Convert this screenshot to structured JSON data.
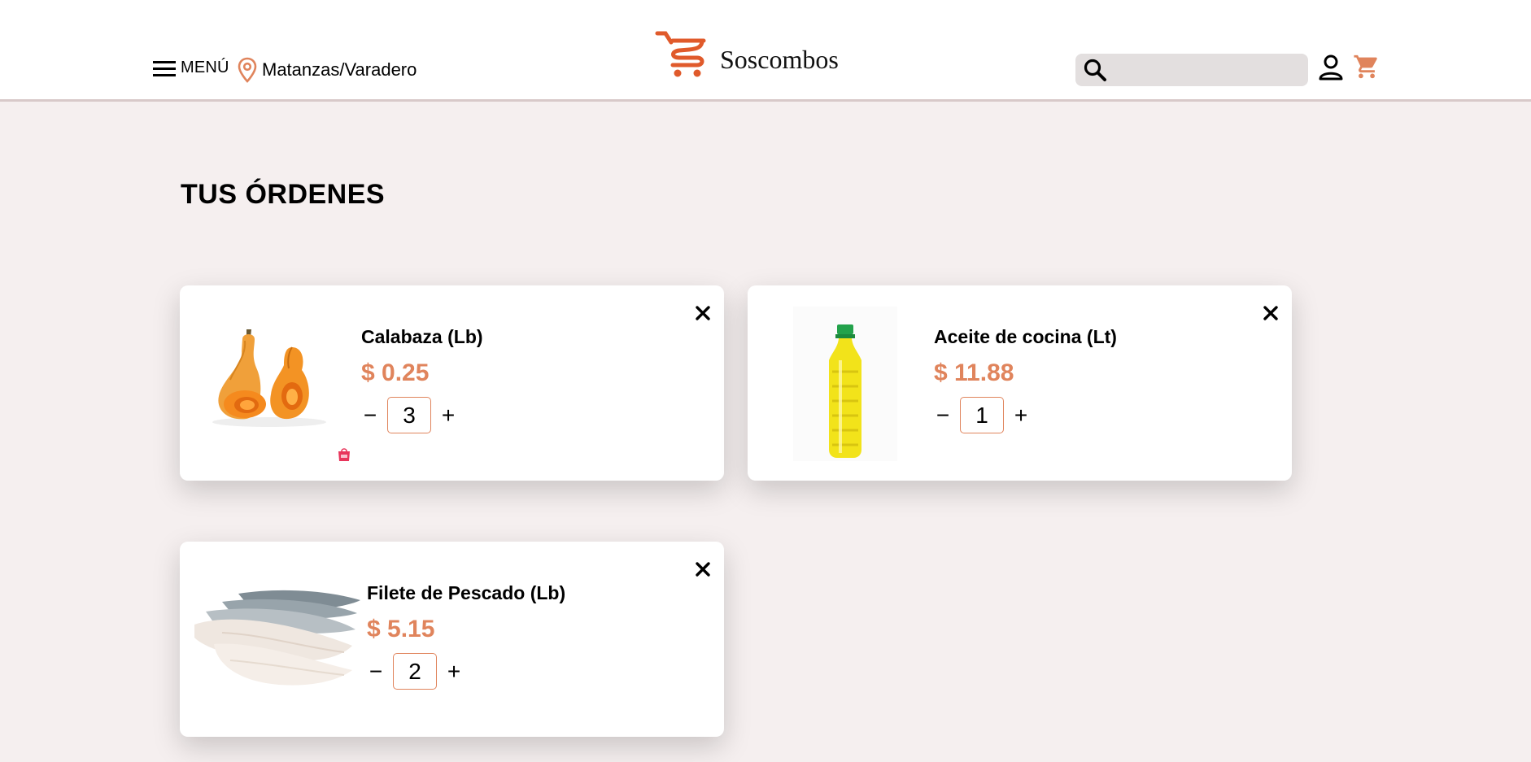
{
  "header": {
    "menu_label": "MENÚ",
    "location": "Matanzas/Varadero",
    "brand": "Soscombos",
    "search_placeholder": "",
    "brand_color": "#e05a2b"
  },
  "page": {
    "title": "TUS ÓRDENES"
  },
  "orders": [
    {
      "name": "Calabaza (Lb)",
      "price": "$ 0.25",
      "quantity": "3",
      "image": "butternut-squash"
    },
    {
      "name": "Aceite de cocina (Lt)",
      "price": "$ 11.88",
      "quantity": "1",
      "image": "cooking-oil-bottle"
    },
    {
      "name": "Filete de Pescado (Lb)",
      "price": "$ 5.15",
      "quantity": "2",
      "image": "fish-fillet"
    }
  ],
  "controls": {
    "minus": "−",
    "plus": "+",
    "remove": "×"
  },
  "colors": {
    "price": "#e0845c",
    "accent": "#e05a2b",
    "background": "#f5efef"
  }
}
